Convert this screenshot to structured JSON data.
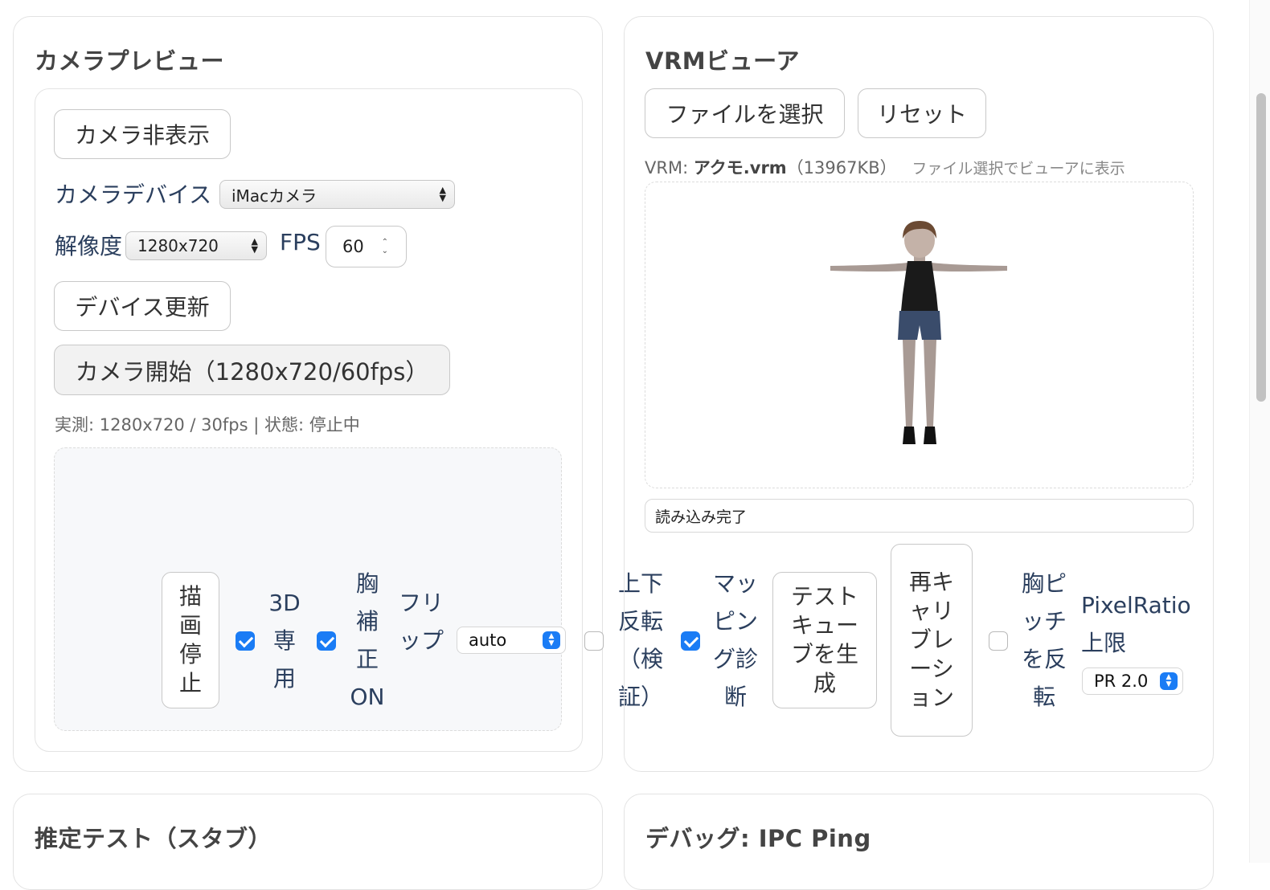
{
  "camera_card": {
    "title": "カメラプレビュー",
    "toggle_button": "カメラ非表示",
    "device_label": "カメラデバイス",
    "device_value": "iMacカメラ",
    "resolution_label": "解像度",
    "resolution_value": "1280x720",
    "fps_label": "FPS",
    "fps_value": "60",
    "refresh_button": "デバイス更新",
    "start_button": "カメラ開始（1280x720/60fps）",
    "status_text": "実測: 1280x720 / 30fps | 状態: 停止中",
    "controls": {
      "stop_draw_button": "描画停止",
      "only3d_label": "3D専用",
      "only3d_checked": true,
      "chest_fix_label": "胸補正ON",
      "chest_fix_checked": true,
      "flip_label": "フリップ",
      "flip_value": "auto",
      "updown_label": "上下反転（検証）",
      "updown_checked": false,
      "mapping_label": "マッピング診断",
      "mapping_checked": true,
      "test_cube_button": "テストキューブを生成",
      "recalibrate_button": "再キャリブレーション",
      "chest_pitch_label": "胸ピッチを反転",
      "chest_pitch_checked": false,
      "pixelratio_label": "PixelRatio上限",
      "pixelratio_value": "PR 2.0"
    }
  },
  "vrm_card": {
    "title": "VRMビューア",
    "file_button": "ファイルを選択",
    "reset_button": "リセット",
    "file_prefix": "VRM: ",
    "file_name": "アクモ.vrm",
    "file_size": "（13967KB）",
    "file_hint": "ファイル選択でビューアに表示",
    "load_status": "読み込み完了"
  },
  "bottom": {
    "left_title": "推定テスト（スタブ）",
    "right_title": "デバッグ: IPC Ping"
  },
  "colors": {
    "accent": "#1a7cf5",
    "label_text": "#2b3f5e"
  }
}
